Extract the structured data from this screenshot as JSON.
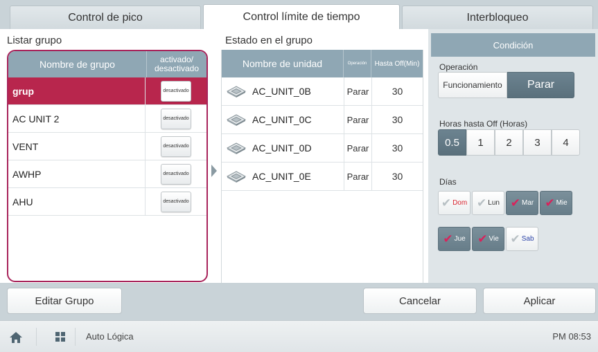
{
  "tabs": [
    "Control de pico",
    "Control límite de tiempo",
    "Interbloqueo"
  ],
  "active_tab": 1,
  "group_panel": {
    "title": "Listar grupo",
    "col_name": "Nombre de grupo",
    "col_status": "activado/\ndesactivado",
    "rows": [
      {
        "name": "grup",
        "status": "desactivado",
        "selected": true
      },
      {
        "name": "AC UNIT 2",
        "status": "desactivado",
        "selected": false
      },
      {
        "name": "VENT",
        "status": "desactivado",
        "selected": false
      },
      {
        "name": "AWHP",
        "status": "desactivado",
        "selected": false
      },
      {
        "name": "AHU",
        "status": "desactivado",
        "selected": false
      }
    ]
  },
  "unit_panel": {
    "title": "Estado en el grupo",
    "col_name": "Nombre de unidad",
    "col_op": "Operación",
    "col_off": "Hasta Off(Min)",
    "rows": [
      {
        "name": "AC_UNIT_0B",
        "op": "Parar",
        "off": "30"
      },
      {
        "name": "AC_UNIT_0C",
        "op": "Parar",
        "off": "30"
      },
      {
        "name": "AC_UNIT_0D",
        "op": "Parar",
        "off": "30"
      },
      {
        "name": "AC_UNIT_0E",
        "op": "Parar",
        "off": "30"
      }
    ]
  },
  "condition": {
    "title": "Condición",
    "op_label": "Operación",
    "op_options": [
      "Funcionamiento",
      "Parar"
    ],
    "op_selected": 1,
    "hours_label": "Horas hasta Off (Horas)",
    "hours_options": [
      "0.5",
      "1",
      "2",
      "3",
      "4"
    ],
    "hours_selected": 0,
    "days_label": "Días",
    "days": [
      {
        "label": "Dom",
        "on": false
      },
      {
        "label": "Lun",
        "on": false
      },
      {
        "label": "Mar",
        "on": true
      },
      {
        "label": "Mie",
        "on": true
      },
      {
        "label": "Jue",
        "on": true
      },
      {
        "label": "Vie",
        "on": true
      },
      {
        "label": "Sab",
        "on": false
      }
    ]
  },
  "buttons": {
    "edit": "Editar Grupo",
    "cancel": "Cancelar",
    "apply": "Aplicar"
  },
  "footer": {
    "app_name": "Auto Lógica",
    "clock": "PM 08:53"
  },
  "colors": {
    "accent": "#b8264d",
    "header": "#8fa7b4",
    "selected_option": "#5a707c",
    "check_on": "#d9225b"
  }
}
